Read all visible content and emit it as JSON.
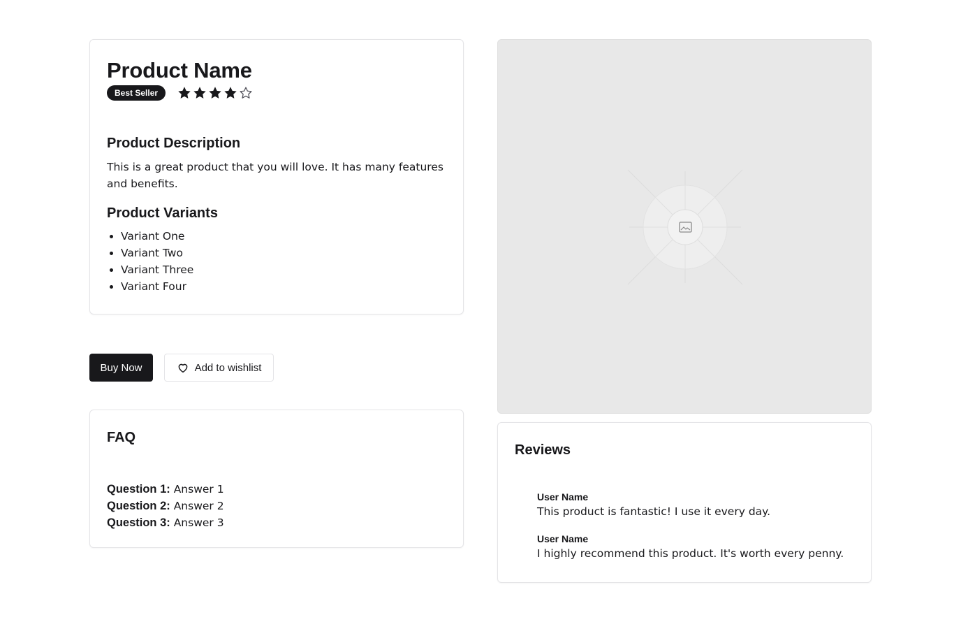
{
  "product": {
    "name": "Product Name",
    "badge": "Best Seller",
    "rating": 4,
    "rating_max": 5,
    "description_title": "Product Description",
    "description": "This is a great product that you will love. It has many features and benefits.",
    "variants_title": "Product Variants",
    "variants": [
      "Variant One",
      "Variant Two",
      "Variant Three",
      "Variant Four"
    ]
  },
  "actions": {
    "buy_label": "Buy Now",
    "wishlist_label": "Add to wishlist",
    "wishlist_icon": "heart-icon"
  },
  "faq": {
    "title": "FAQ",
    "items": [
      {
        "q": "Question 1:",
        "a": "Answer 1"
      },
      {
        "q": "Question 2:",
        "a": "Answer 2"
      },
      {
        "q": "Question 3:",
        "a": "Answer 3"
      }
    ]
  },
  "image": {
    "icon": "image-placeholder-icon"
  },
  "reviews": {
    "title": "Reviews",
    "items": [
      {
        "user": "User Name",
        "text": "This product is fantastic! I use it every day."
      },
      {
        "user": "User Name",
        "text": "I highly recommend this product. It's worth every penny."
      }
    ]
  },
  "colors": {
    "primary": "#18181b",
    "border": "#e4e4e7",
    "placeholder_bg": "#e8e8e8"
  }
}
